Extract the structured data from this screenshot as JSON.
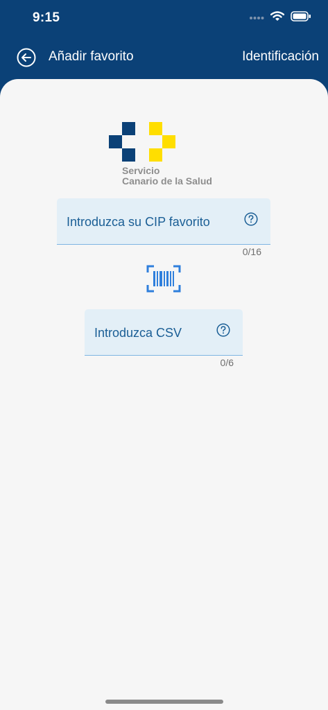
{
  "status_bar": {
    "time": "9:15",
    "icons": [
      "signal-icon",
      "wifi-icon",
      "battery-icon"
    ]
  },
  "header": {
    "title": "Añadir favorito",
    "action_label": "Identificación",
    "back_icon": "back-arrow-icon"
  },
  "logo": {
    "line1": "Servicio",
    "line2": "Canario de la Salud",
    "colors": {
      "blue": "#0b4177",
      "yellow": "#ffde00"
    }
  },
  "cip_field": {
    "label": "Introduzca su CIP favorito",
    "counter": "0/16",
    "help_icon": "help-circle-icon"
  },
  "barcode": {
    "icon": "barcode-scan-icon"
  },
  "csv_field": {
    "label": "Introduzca CSV",
    "counter": "0/6",
    "help_icon": "help-circle-icon"
  },
  "colors": {
    "header_bg": "#0b4177",
    "content_bg": "#f6f6f6",
    "field_bg": "#e3eff7",
    "accent": "#1a5e95",
    "barcode_blue": "#2f7fdc"
  }
}
